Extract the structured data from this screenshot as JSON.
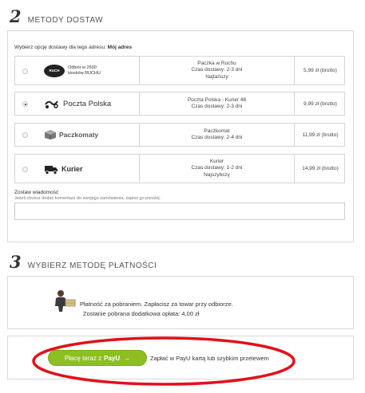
{
  "section2": {
    "number": "2",
    "title": "METODY DOSTAW"
  },
  "prompt": {
    "text": "Wybierz opcję dostawy dla tego adresu:",
    "address": "Mój adres"
  },
  "options": [
    {
      "selected": false,
      "logo_icon": "ruch-logo-icon",
      "logo_badge": "RUCH",
      "logo_text_1": "Odbiór w 2500",
      "logo_text_2": "kiosków RUCHU",
      "desc": [
        "Paczka w Ruchu",
        "Czas dostawy: 2-3 dni",
        "Najtańszy"
      ],
      "price": "5,99 zł (brutto)"
    },
    {
      "selected": true,
      "logo_icon": "poczta-polska-logo-icon",
      "logo_text": "Poczta Polska",
      "desc": [
        "Poczta Polska - Kurier 48",
        "Czas dostawy: 2-3 dni"
      ],
      "price": "9,99 zł (brutto)"
    },
    {
      "selected": false,
      "logo_icon": "paczkomaty-logo-icon",
      "logo_text": "Paczkomaty",
      "desc": [
        "Paczkomat",
        "Czas dostawy: 2-4 dni"
      ],
      "price": "11,99 zł (brutto)"
    },
    {
      "selected": false,
      "logo_icon": "kurier-truck-icon",
      "logo_text": "Kurier",
      "desc": [
        "Kurier",
        "Czas dostawy: 1-2 dni",
        "Najszybszy"
      ],
      "price": "14,99 zł (brutto)"
    }
  ],
  "comment": {
    "label": "Zostaw wiadomość",
    "hint": "Jeżeli chcesz dodać komentarz do swojego zamówienia, zapisz go poniżej.",
    "value": ""
  },
  "section3": {
    "number": "3",
    "title": "WYBIERZ METODĘ PŁATNOŚCI"
  },
  "cod": {
    "icon": "cash-on-delivery-icon",
    "line1": "Płatność za pobraniem. Zapłacisz za towar przy odbiorze.",
    "line2": "Zostanie pobrana dodatkowa opłata: 4,00 zł"
  },
  "payu": {
    "button_prefix": "Płacę teraz z",
    "button_brand": "PayU",
    "button_arrow": "→",
    "description": "Zapłać w PayU kartą lub szybkim przelewem"
  },
  "colors": {
    "payu_green": "#8dbf21",
    "annotation_red": "#e3101a"
  }
}
